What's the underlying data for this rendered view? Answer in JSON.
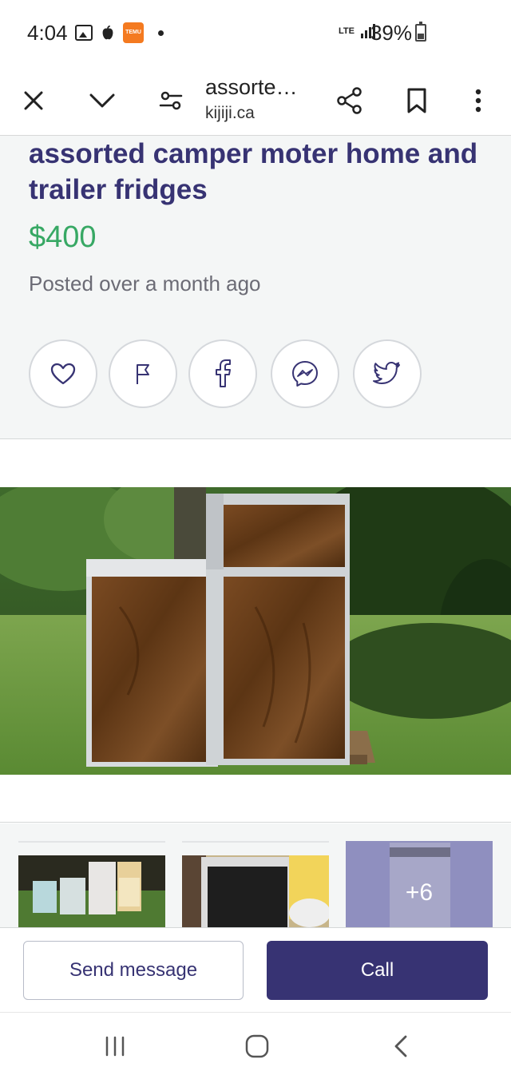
{
  "status_bar": {
    "time": "4:04",
    "temu_label": "TEMU",
    "network": "LTE",
    "battery": "39%"
  },
  "browser": {
    "page_title": "assorte…",
    "domain": "kijiji.ca",
    "icons": [
      "close-icon",
      "chevron-down-icon",
      "tune-icon",
      "share-icon",
      "bookmark-icon",
      "more-vert-icon"
    ]
  },
  "listing": {
    "title": "assorted camper moter home and trailer fridges",
    "price": "$400",
    "posted": "Posted over a month ago"
  },
  "share_actions": [
    "heart-icon",
    "flag-icon",
    "facebook-icon",
    "messenger-icon",
    "twitter-icon"
  ],
  "gallery": {
    "more_count": "+6"
  },
  "actions": {
    "send_message": "Send message",
    "call": "Call"
  },
  "colors": {
    "brand_navy": "#373373",
    "price_green": "#37a864",
    "background": "#f4f6f6"
  }
}
